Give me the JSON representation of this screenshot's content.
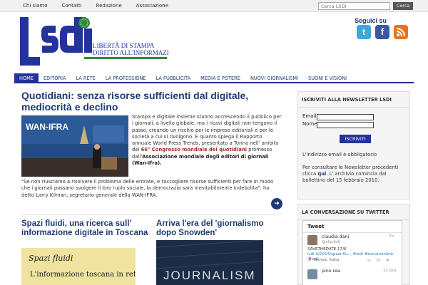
{
  "topbar": {
    "links": [
      "Chi siamo",
      "Contatti",
      "Redazione",
      "Associazione"
    ],
    "search_placeholder": "Cerca LSDI",
    "search_button": "Cerca"
  },
  "logo": {
    "text": "lsdi",
    "tagline_1": "LIBERTÀ DI STAMPA",
    "tagline_2": "DIRITTO ALL'INFORMAZIONE"
  },
  "social": {
    "title": "Seguici su",
    "icons": [
      "twitter-icon",
      "facebook-icon",
      "rss-icon"
    ]
  },
  "mainnav": {
    "items": [
      "HOME",
      "EDITORIA",
      "LA RETE",
      "LA PROFESSIONE",
      "LA PUBBLICITÀ",
      "MEDIA E POTERE",
      "NUOVI GIORNALISMI",
      "SUONI E VISIONI"
    ]
  },
  "article": {
    "title": "Quotidiani: senza risorse sufficienti dal digitale, mediocrità e declino",
    "image_caption": "WAN-IFRA",
    "body_1": "Stampa e digitale insieme stanno accrescendo il pubblico per i giornali, a livello globale, ma i ricavi digitali non tengono il passo, creando un rischio per le imprese editoriali e per le società a cui si rivolgono. E quanto spiega il Rapporto annuale World Press Trends, presentato a Torino nell' ambito del",
    "body_link": "66° Congresso mondiale dei quotidiani",
    "body_2": "promosso dall'",
    "body_bold": "Associazione mondiale degli editori di giornali (Wan-Ifra).",
    "body_3": "\"Se non riusciamo a risolvere il problema delle entrate, e raccogliere risorse sufficienti per fare in modo che i giornali possano svolgere il loro ruolo sociale, la democrazia sarà inevitabilmente indebolita\", ha detto  Larry Kilman, segretario generale della WAN-IFRA."
  },
  "article2": {
    "title": "Spazi fluidi, una ricerca sull' informazione digitale in Toscana",
    "image_text_1": "Spazi fluidi",
    "image_text_2": "L'informazione toscana in rete"
  },
  "article3": {
    "title": "Arriva l'era del 'giornalismo dopo Snowden'",
    "image_text": "JOURNALISM"
  },
  "newsletter": {
    "title": "ISCRIVITI ALLA NEWSLETTER LSDI",
    "email_label": "Email",
    "name_label": "Nome",
    "button": "ISCRIVITI",
    "note": "L'indirizzo email è obbligatorio",
    "text_1": "Per consultare le Newsletter precedenti clicca",
    "link": "qui",
    "text_2": ". L' archivio comincia dal bollettino del 15 febbraio 2010."
  },
  "twitter": {
    "title": "LA CONVERSAZIONE SU TWITTER",
    "box_title": "Tweet",
    "tweets": [
      {
        "name": "claudia dani",
        "handle": "@claclick",
        "time": "7h",
        "text": "SAVETHEDATE 17/6",
        "links": "lsdi.it/2014/spazi-flu... #lsdi #toscanonline @lsdi",
        "location": "Genoa, Italia"
      },
      {
        "name": "pino rea",
        "handle": "",
        "time": "11 Giu",
        "text": "",
        "links": "",
        "location": ""
      }
    ]
  },
  "colors": {
    "brand_blue": "#1f3a75",
    "nav_active": "#23339b",
    "logo_green": "#2f8a3a"
  }
}
